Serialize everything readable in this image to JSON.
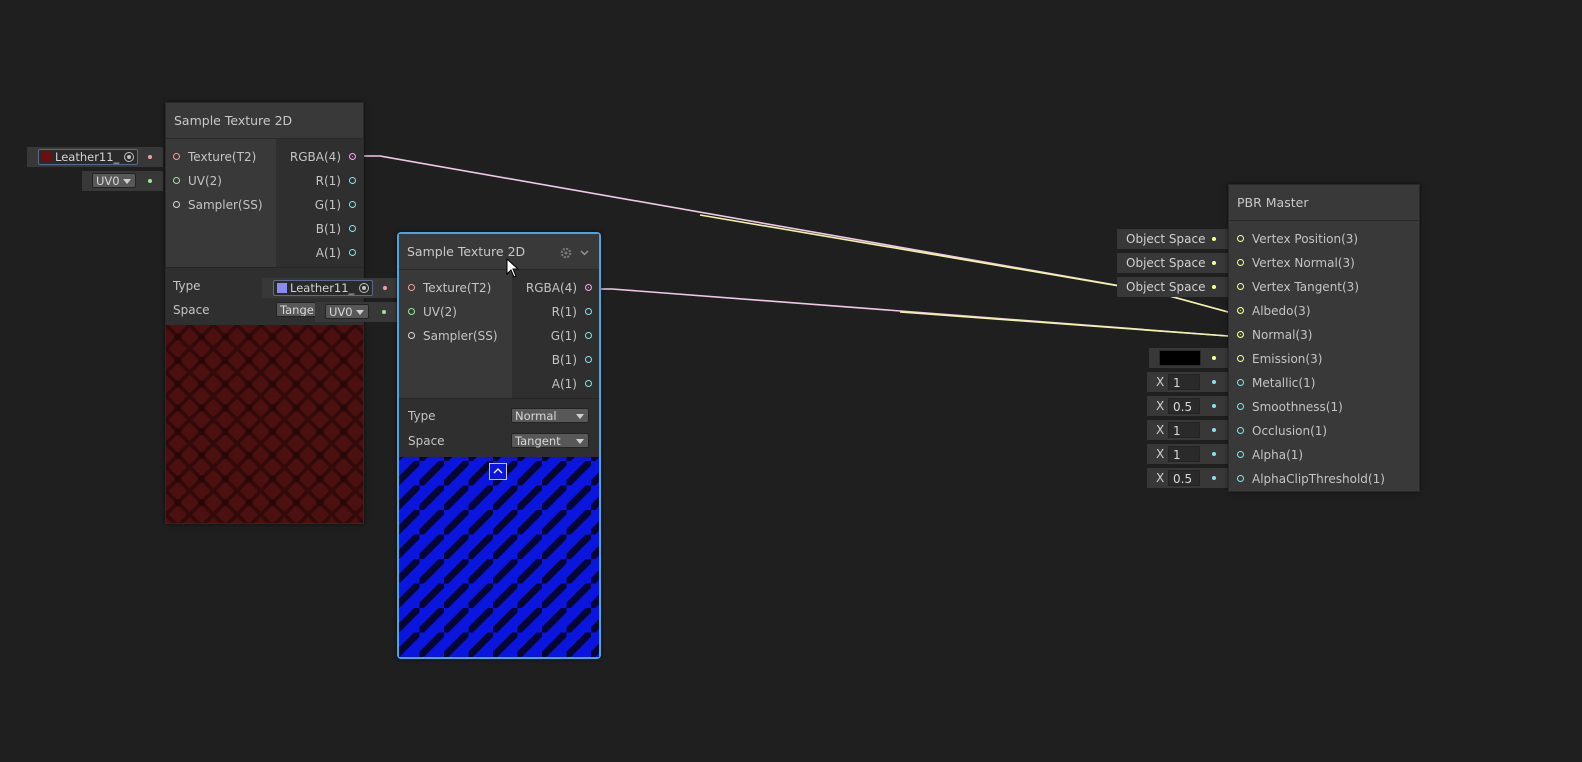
{
  "colors": {
    "background": "#1f1f1f",
    "node_body": "#393939",
    "selection": "#48a6e6",
    "texture_port": "#f0a0a0",
    "uv_port": "#9ce49c",
    "vector4_port": "#f0a0f0",
    "vector3_port": "#f6ff9a",
    "vector1_port": "#84e4e7",
    "wire_rgba": "#f0c8e8",
    "wire_vec3": "#f2f2a8"
  },
  "node1": {
    "title": "Sample Texture 2D",
    "inputs": [
      "Texture(T2)",
      "UV(2)",
      "Sampler(SS)"
    ],
    "outputs": [
      "RGBA(4)",
      "R(1)",
      "G(1)",
      "B(1)",
      "A(1)"
    ],
    "type_label": "Type",
    "space_label": "Space",
    "space_value": "Tange",
    "texture_input_value": "Leather11_",
    "uv_input_value": "UV0",
    "preview_icon": "leather-red-texture"
  },
  "node2": {
    "title": "Sample Texture 2D",
    "settings_icon": "gear-icon",
    "collapse_icon": "chevron-down-icon",
    "inputs": [
      "Texture(T2)",
      "UV(2)",
      "Sampler(SS)"
    ],
    "outputs": [
      "RGBA(4)",
      "R(1)",
      "G(1)",
      "B(1)",
      "A(1)"
    ],
    "type_label": "Type",
    "type_value": "Normal",
    "space_label": "Space",
    "space_value": "Tangent",
    "texture_input_value": "Leather11_",
    "uv_input_value": "UV0",
    "preview_icon": "leather-normal-map"
  },
  "master": {
    "title": "PBR Master",
    "inputs": [
      {
        "label": "Vertex Position(3)",
        "field": "Object Space",
        "kind": "space"
      },
      {
        "label": "Vertex Normal(3)",
        "field": "Object Space",
        "kind": "space"
      },
      {
        "label": "Vertex Tangent(3)",
        "field": "Object Space",
        "kind": "space"
      },
      {
        "label": "Albedo(3)",
        "kind": "connected"
      },
      {
        "label": "Normal(3)",
        "kind": "connected"
      },
      {
        "label": "Emission(3)",
        "kind": "color",
        "color": "#000000"
      },
      {
        "label": "Metallic(1)",
        "kind": "number",
        "axis": "X",
        "value": "1"
      },
      {
        "label": "Smoothness(1)",
        "kind": "number",
        "axis": "X",
        "value": "0.5"
      },
      {
        "label": "Occlusion(1)",
        "kind": "number",
        "axis": "X",
        "value": "1"
      },
      {
        "label": "Alpha(1)",
        "kind": "number",
        "axis": "X",
        "value": "1"
      },
      {
        "label": "AlphaClipThreshold(1)",
        "kind": "number",
        "axis": "X",
        "value": "0.5"
      }
    ]
  }
}
